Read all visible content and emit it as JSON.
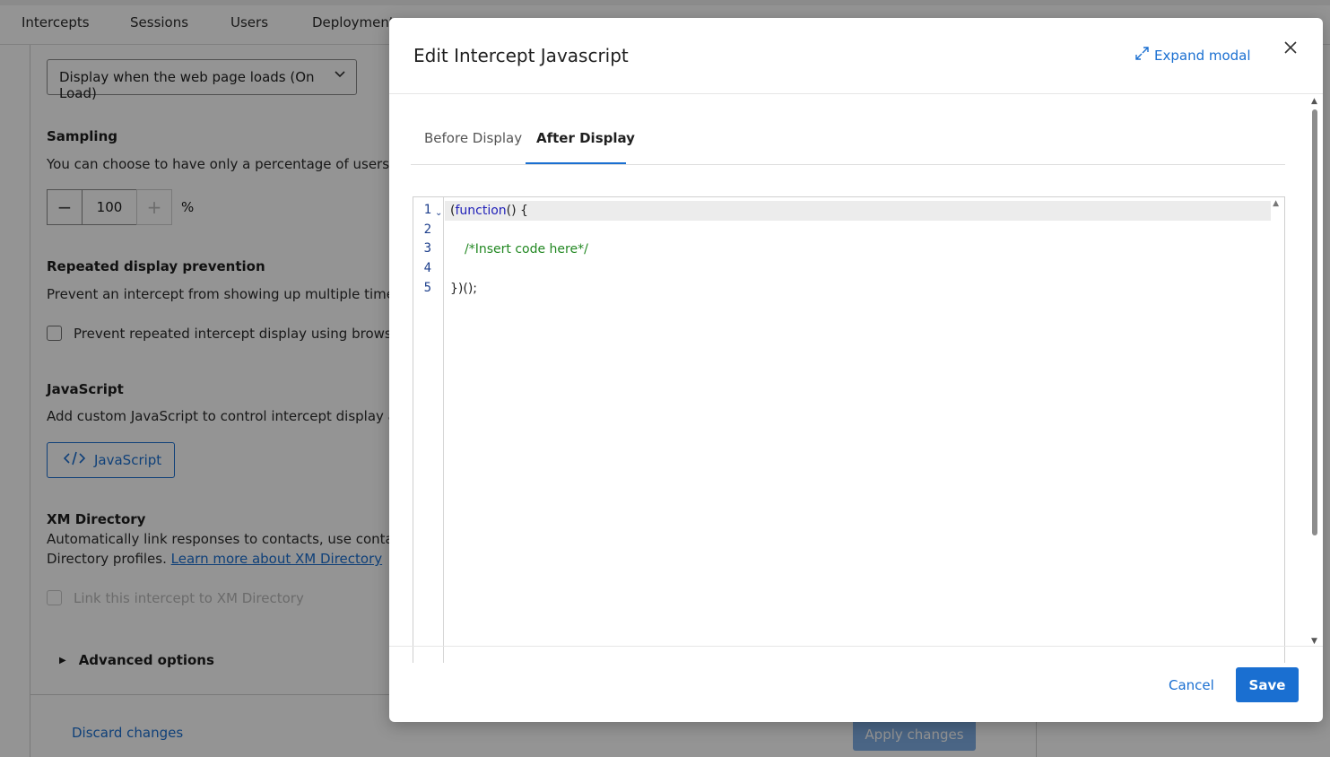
{
  "top_tabs": [
    {
      "label": "Intercepts"
    },
    {
      "label": "Sessions"
    },
    {
      "label": "Users"
    },
    {
      "label": "Deployment"
    }
  ],
  "display_select": {
    "value": "Display when the web page loads (On Load)"
  },
  "sampling": {
    "heading": "Sampling",
    "description": "You can choose to have only a percentage of users to se",
    "value": "100",
    "unit": "%"
  },
  "repeated": {
    "heading": "Repeated display prevention",
    "description": "Prevent an intercept from showing up multiple times by p",
    "checkbox_label": "Prevent repeated intercept display using browser co"
  },
  "javascript": {
    "heading": "JavaScript",
    "description": "Add custom JavaScript to control intercept display and d",
    "button_label": "JavaScript"
  },
  "xm_directory": {
    "heading": "XM Directory",
    "description_line1": "Automatically link responses to contacts, use contact fre",
    "description_line2": "Directory profiles.",
    "link": "Learn more about XM Directory",
    "checkbox_label": "Link this intercept to XM Directory"
  },
  "advanced": {
    "label": "Advanced options"
  },
  "footer": {
    "discard": "Discard changes",
    "apply": "Apply changes"
  },
  "modal": {
    "title": "Edit Intercept Javascript",
    "expand_label": "Expand modal",
    "tabs": [
      {
        "label": "Before Display"
      },
      {
        "label": "After Display"
      }
    ],
    "editor": {
      "line_numbers": [
        "1",
        "2",
        "3",
        "4",
        "5"
      ],
      "line1_paren": "(",
      "line1_keyword": "function",
      "line1_rest": "() {",
      "line3_comment": "/*Insert code here*/",
      "line5": "})();"
    },
    "cancel": "Cancel",
    "save": "Save"
  },
  "colors": {
    "accent": "#1a6fd1",
    "comment": "#228822",
    "keyword": "#1f1fb8"
  }
}
